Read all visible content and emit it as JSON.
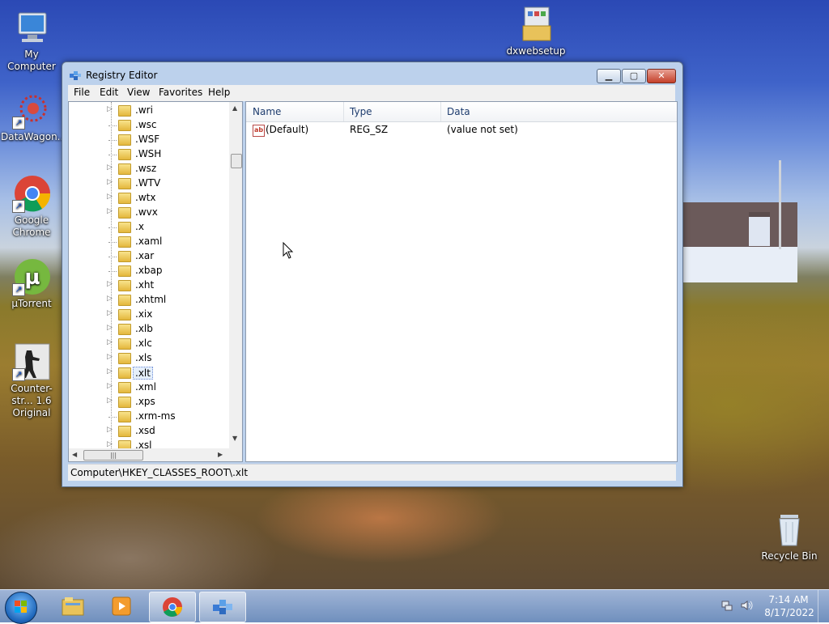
{
  "desktop": {
    "icons": [
      {
        "label": "My Computer",
        "icon": "computer-icon"
      },
      {
        "label": "DataWagon...",
        "icon": "datawagon-icon"
      },
      {
        "label": "Google Chrome",
        "icon": "chrome-icon"
      },
      {
        "label": "μTorrent",
        "icon": "utorrent-icon"
      },
      {
        "label": "Counter-str... 1.6 Original",
        "icon": "counter-strike-icon"
      },
      {
        "label": "dxwebsetup",
        "icon": "installer-icon"
      },
      {
        "label": "Recycle Bin",
        "icon": "recycle-bin-icon"
      }
    ]
  },
  "window": {
    "title": "Registry Editor",
    "menu": [
      "File",
      "Edit",
      "View",
      "Favorites",
      "Help"
    ],
    "tree": {
      "items": [
        {
          "label": ".wri",
          "expandable": true
        },
        {
          "label": ".wsc",
          "expandable": false
        },
        {
          "label": ".WSF",
          "expandable": false
        },
        {
          "label": ".WSH",
          "expandable": false
        },
        {
          "label": ".wsz",
          "expandable": true
        },
        {
          "label": ".WTV",
          "expandable": true
        },
        {
          "label": ".wtx",
          "expandable": true
        },
        {
          "label": ".wvx",
          "expandable": true
        },
        {
          "label": ".x",
          "expandable": false
        },
        {
          "label": ".xaml",
          "expandable": false
        },
        {
          "label": ".xar",
          "expandable": false
        },
        {
          "label": ".xbap",
          "expandable": false
        },
        {
          "label": ".xht",
          "expandable": true
        },
        {
          "label": ".xhtml",
          "expandable": true
        },
        {
          "label": ".xix",
          "expandable": true
        },
        {
          "label": ".xlb",
          "expandable": true
        },
        {
          "label": ".xlc",
          "expandable": true
        },
        {
          "label": ".xls",
          "expandable": true
        },
        {
          "label": ".xlt",
          "expandable": true,
          "selected": true
        },
        {
          "label": ".xml",
          "expandable": true
        },
        {
          "label": ".xps",
          "expandable": true
        },
        {
          "label": ".xrm-ms",
          "expandable": false
        },
        {
          "label": ".xsd",
          "expandable": true
        },
        {
          "label": ".xsl",
          "expandable": true
        }
      ]
    },
    "list": {
      "columns": [
        "Name",
        "Type",
        "Data"
      ],
      "rows": [
        {
          "name": "(Default)",
          "type": "REG_SZ",
          "data": "(value not set)"
        }
      ]
    },
    "status": "Computer\\HKEY_CLASSES_ROOT\\.xlt"
  },
  "taskbar": {
    "items": [
      {
        "name": "file-explorer",
        "active": false
      },
      {
        "name": "media-player",
        "active": false
      },
      {
        "name": "chrome",
        "active": true
      },
      {
        "name": "registry-editor",
        "active": true
      }
    ],
    "clock": {
      "time": "7:14 AM",
      "date": "8/17/2022"
    }
  },
  "colors": {
    "title_bar": "#bcd1ec",
    "close_button": "#c4402a",
    "taskbar": "#6f8fbd",
    "selection": "#e5effb"
  }
}
